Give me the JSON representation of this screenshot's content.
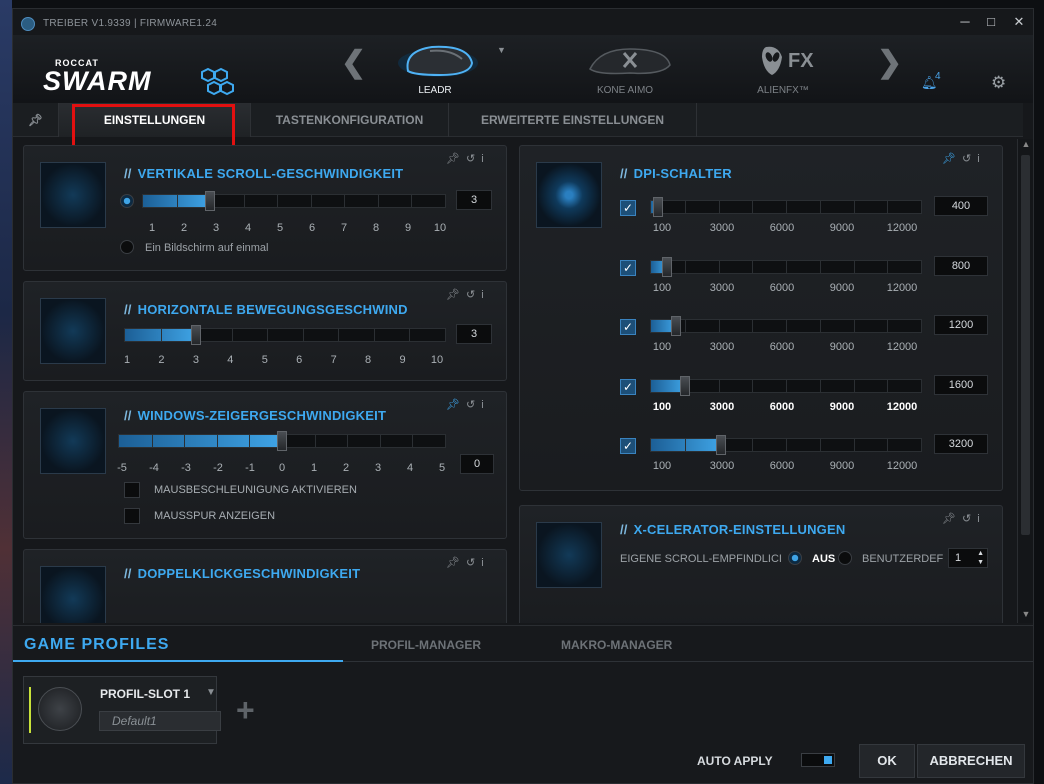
{
  "title_bar": {
    "text": "TREIBER V1.9339 | FIRMWARE1.24",
    "minimize": "─",
    "maximize": "□",
    "close": "✕"
  },
  "brand": {
    "top": "ROCCAT",
    "name": "SWARM"
  },
  "devices": [
    {
      "label": "LEADR",
      "active": true
    },
    {
      "label": "KONE AIMO",
      "active": false
    },
    {
      "label": "ALIENFX™",
      "active": false,
      "logo_text": "FX"
    }
  ],
  "notifications": {
    "count": "4"
  },
  "tabs": [
    "EINSTELLUNGEN",
    "TASTENKONFIGURATION",
    "ERWEITERTE EINSTELLUNGEN"
  ],
  "panels": {
    "vertical_scroll": {
      "title": "VERTIKALE SCROLL-GESCHWINDIGKEIT",
      "value": "3",
      "scale": [
        "1",
        "2",
        "3",
        "4",
        "5",
        "6",
        "7",
        "8",
        "9",
        "10"
      ],
      "option": "Ein Bildschirm auf einmal"
    },
    "horizontal": {
      "title": "HORIZONTALE BEWEGUNGSGESCHWIND",
      "value": "3",
      "scale": [
        "1",
        "2",
        "3",
        "4",
        "5",
        "6",
        "7",
        "8",
        "9",
        "10"
      ]
    },
    "pointer": {
      "title": "WINDOWS-ZEIGERGESCHWINDIGKEIT",
      "value": "0",
      "scale": [
        "-5",
        "-4",
        "-3",
        "-2",
        "-1",
        "0",
        "1",
        "2",
        "3",
        "4",
        "5"
      ],
      "checkbox1": "MAUSBESCHLEUNIGUNG AKTIVIEREN",
      "checkbox2": "MAUSSPUR ANZEIGEN"
    },
    "doubleclick": {
      "title": "DOPPELKLICKGESCHWINDIGKEIT"
    },
    "dpi": {
      "title": "DPI-SCHALTER",
      "scale": [
        "100",
        "3000",
        "6000",
        "9000",
        "12000"
      ],
      "rows": [
        {
          "value": "400",
          "fraction": 0.025
        },
        {
          "value": "800",
          "fraction": 0.058
        },
        {
          "value": "1200",
          "fraction": 0.092
        },
        {
          "value": "1600",
          "fraction": 0.126
        },
        {
          "value": "3200",
          "fraction": 0.26
        }
      ]
    },
    "xcelerator": {
      "title": "X-CELERATOR-EINSTELLUNGEN",
      "label": "EIGENE SCROLL-EMPFINDLICI",
      "off": "AUS",
      "custom": "BENUTZERDEF",
      "value": "1"
    }
  },
  "bottom": {
    "title": "GAME PROFILES",
    "tab1": "PROFIL-MANAGER",
    "tab2": "MAKRO-MANAGER",
    "slot_name": "PROFIL-SLOT 1",
    "slot_default": "Default1",
    "auto_apply": "AUTO APPLY",
    "ok": "OK",
    "cancel": "ABBRECHEN"
  },
  "colors": {
    "accent": "#3ea9f0",
    "highlight": "#e21010",
    "background": "#16181b"
  }
}
